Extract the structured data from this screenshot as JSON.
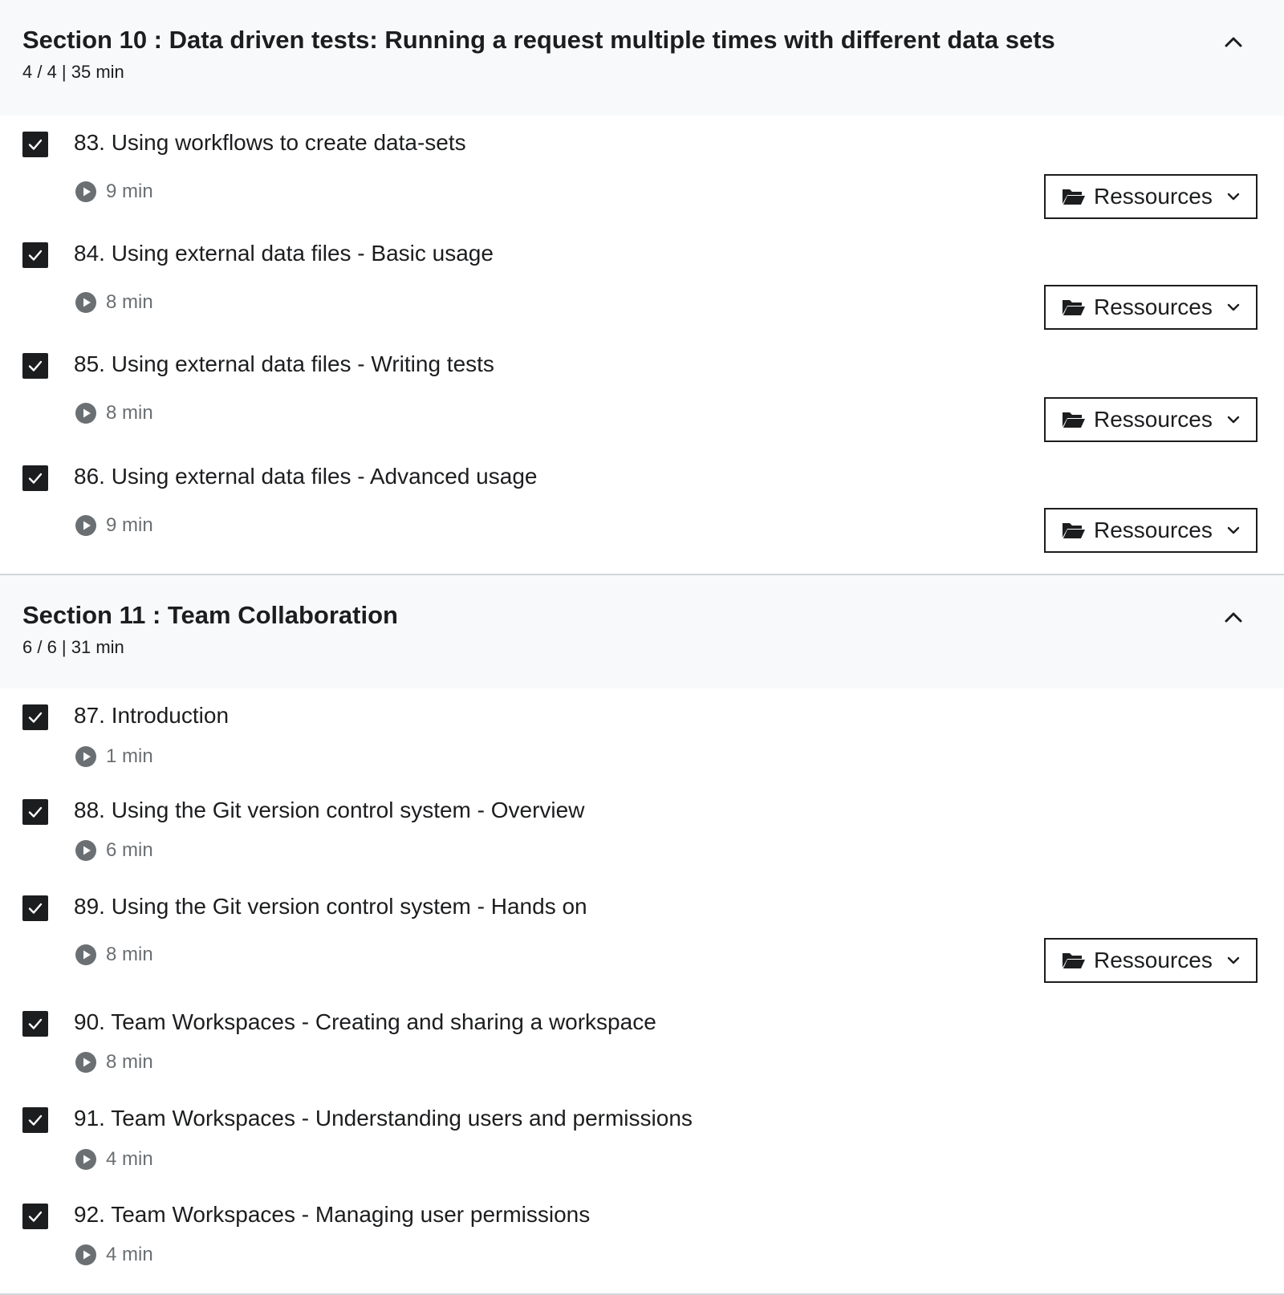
{
  "sections": [
    {
      "title": "Section 10 : Data driven tests: Running a request multiple times with different data sets",
      "meta": "4 / 4 | 35 min",
      "expanded": true,
      "lectures": [
        {
          "title": "83. Using workflows to create data-sets",
          "duration": "9 min",
          "completed": true,
          "resources_label": "Ressources"
        },
        {
          "title": "84. Using external data files - Basic usage",
          "duration": "8 min",
          "completed": true,
          "resources_label": "Ressources"
        },
        {
          "title": "85. Using external data files - Writing tests",
          "duration": "8 min",
          "completed": true,
          "resources_label": "Ressources"
        },
        {
          "title": "86. Using external data files - Advanced usage",
          "duration": "9 min",
          "completed": true,
          "resources_label": "Ressources"
        }
      ]
    },
    {
      "title": "Section 11 : Team Collaboration",
      "meta": "6 / 6 | 31 min",
      "expanded": true,
      "lectures": [
        {
          "title": "87. Introduction",
          "duration": "1 min",
          "completed": true
        },
        {
          "title": "88. Using the Git version control system - Overview",
          "duration": "6 min",
          "completed": true
        },
        {
          "title": "89. Using the Git version control system - Hands on",
          "duration": "8 min",
          "completed": true,
          "resources_label": "Ressources"
        },
        {
          "title": "90. Team Workspaces - Creating and sharing a workspace",
          "duration": "8 min",
          "completed": true
        },
        {
          "title": "91. Team Workspaces - Understanding users and permissions",
          "duration": "4 min",
          "completed": true
        },
        {
          "title": "92. Team Workspaces - Managing user permissions",
          "duration": "4 min",
          "completed": true
        }
      ]
    }
  ],
  "icons": {
    "section_toggle": "chevron-up-icon",
    "lecture_status": "check-icon",
    "lecture_type": "play-circle-icon",
    "resources": "folder-open-icon",
    "resources_dropdown": "chevron-down-icon"
  }
}
